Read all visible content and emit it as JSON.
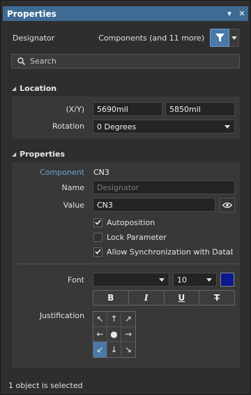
{
  "titlebar": {
    "title": "Properties",
    "pin_icon": "▾",
    "close_icon": "✕"
  },
  "top": {
    "label": "Designator",
    "filter_text": "Components (and 11 more)"
  },
  "search": {
    "placeholder": "Search"
  },
  "location": {
    "header": "Location",
    "xy_label": "(X/Y)",
    "x_value": "5690mil",
    "y_value": "5850mil",
    "rotation_label": "Rotation",
    "rotation_value": "0 Degrees"
  },
  "properties": {
    "header": "Properties",
    "component_label": "Component",
    "component_value": "CN3",
    "name_label": "Name",
    "name_placeholder": "Designator",
    "value_label": "Value",
    "value_value": "CN3",
    "autoposition": {
      "label": "Autoposition",
      "checked": true
    },
    "lock_parameter": {
      "label": "Lock Parameter",
      "checked": false
    },
    "allow_sync": {
      "label": "Allow Synchronization with Database",
      "checked": true
    },
    "font_label": "Font",
    "font_value": "",
    "font_size": "10",
    "font_color": "#0a1a8c",
    "bold_label": "B",
    "italic_label": "I",
    "underline_label": "U",
    "strike_label": "T",
    "justification_label": "Justification",
    "justification_arrows": [
      "↖",
      "↑",
      "↗",
      "←",
      "●",
      "→",
      "↙",
      "↓",
      "↘"
    ],
    "justification_selected": "bottom-left"
  },
  "status": {
    "text": "1 object is selected"
  },
  "colors": {
    "accent": "#4a79a8",
    "titlebar": "#3e6b94",
    "component_label": "#6ea6d8"
  }
}
